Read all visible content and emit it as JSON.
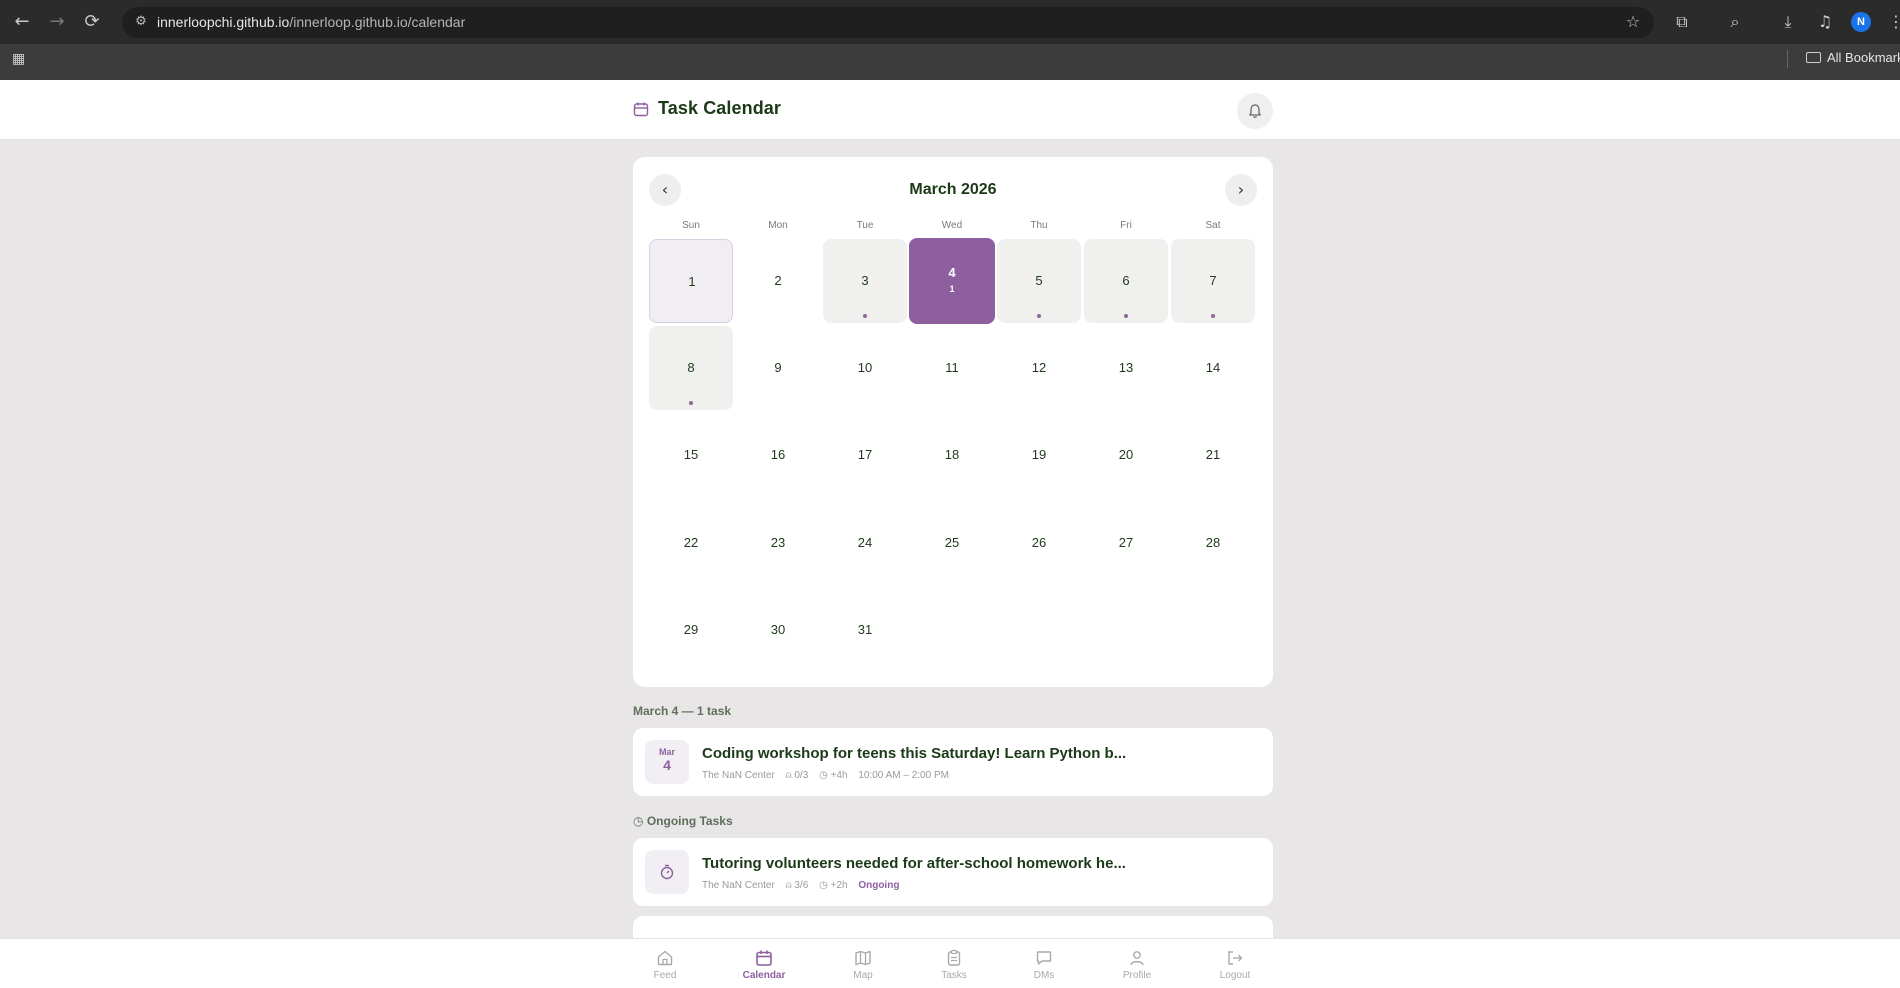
{
  "browser": {
    "url_host": "innerloopchi.github.io",
    "url_path": "/innerloop.github.io/calendar",
    "profile_initial": "N",
    "bookmarks_label": "All Bookmarks"
  },
  "header": {
    "title": "Task Calendar"
  },
  "calendar": {
    "month_label": "March 2026",
    "weekdays": [
      "Sun",
      "Mon",
      "Tue",
      "Wed",
      "Thu",
      "Fri",
      "Sat"
    ],
    "days": [
      "1",
      "2",
      "3",
      "4",
      "5",
      "6",
      "7",
      "8",
      "9",
      "10",
      "11",
      "12",
      "13",
      "14",
      "15",
      "16",
      "17",
      "18",
      "19",
      "20",
      "21",
      "22",
      "23",
      "24",
      "25",
      "26",
      "27",
      "28",
      "29",
      "30",
      "31"
    ],
    "selected_day": "4",
    "selected_count": "1",
    "task_days": [
      "3",
      "4",
      "5",
      "6",
      "7",
      "8"
    ]
  },
  "selected_section": {
    "label": "March 4 — 1 task",
    "task": {
      "badge_month": "Mar",
      "badge_day": "4",
      "title": "Coding workshop for teens this Saturday! Learn Python b...",
      "org": "The NaN Center",
      "slots": "0/3",
      "hours": "+4h",
      "time": "10:00 AM – 2:00 PM"
    }
  },
  "ongoing_section": {
    "label": "Ongoing Tasks",
    "task": {
      "title": "Tutoring volunteers needed for after-school homework he...",
      "org": "The NaN Center",
      "slots": "3/6",
      "hours": "+2h",
      "status": "Ongoing"
    }
  },
  "nav": {
    "feed": "Feed",
    "calendar": "Calendar",
    "map": "Map",
    "tasks": "Tasks",
    "dms": "DMs",
    "profile": "Profile",
    "logout": "Logout"
  },
  "colors": {
    "accent": "#8e5f9e",
    "text": "#1b3a17"
  }
}
